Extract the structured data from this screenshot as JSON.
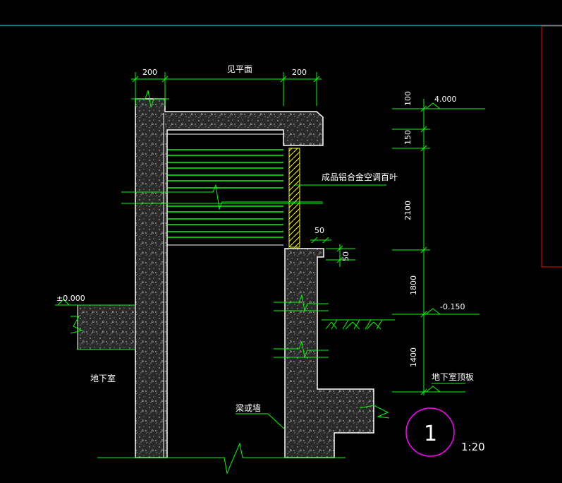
{
  "drawing": {
    "background": "#000000",
    "colors": {
      "line": "#00ff00",
      "text": "#ffffff",
      "wall": "#ffffff",
      "stripe": "#ffff00",
      "guide": "#00ffff",
      "frame": "#ff0000",
      "mark": "#ff00ff"
    },
    "dims_top": {
      "left": "200",
      "middle": "见平面",
      "right": "200"
    },
    "dims_side": {
      "d100": "100",
      "d150": "150",
      "d2100": "2100",
      "d1800": "1800",
      "d1400": "1400",
      "d50a": "50",
      "d50b": "50"
    },
    "elevations": {
      "top": "4.000",
      "ground_right": "-0.150",
      "ground_left": "±0.000"
    },
    "labels": {
      "louver": "成品铝合金空调百叶",
      "basement": "地下室",
      "beam_wall": "梁或墙",
      "basement_roof": "地下室顶板"
    },
    "detail": {
      "number": "1",
      "scale": "1:20"
    }
  }
}
